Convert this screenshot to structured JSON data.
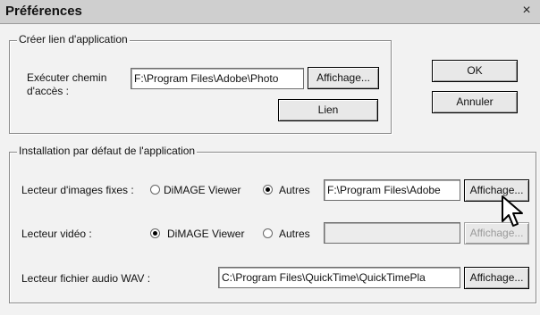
{
  "window": {
    "title": "Préférences",
    "close_glyph": "×"
  },
  "app_link": {
    "legend": "Créer lien d'application",
    "path_label_line1": "Exécuter chemin",
    "path_label_line2": "d'accès :",
    "path_value": "F:\\Program Files\\Adobe\\Photo",
    "browse_label": "Affichage...",
    "link_label": "Lien"
  },
  "buttons": {
    "ok_label": "OK",
    "cancel_label": "Annuler"
  },
  "defaults": {
    "legend": "Installation par défaut de l'application",
    "still": {
      "label": "Lecteur d'images fixes :",
      "option1": "DiMAGE Viewer",
      "option2": "Autres",
      "selected": "Autres",
      "path_value": "F:\\Program Files\\Adobe",
      "browse_label": "Affichage..."
    },
    "video": {
      "label": "Lecteur vidéo :",
      "option1": "DiMAGE Viewer",
      "option2": "Autres",
      "selected": "DiMAGE Viewer",
      "path_value": "",
      "browse_label": "Affichage..."
    },
    "audio": {
      "label": "Lecteur fichier audio WAV :",
      "path_value": "C:\\Program Files\\QuickTime\\QuickTimePla",
      "browse_label": "Affichage..."
    }
  },
  "icons": {
    "close": "close-icon",
    "cursor": "mouse-pointer-icon"
  }
}
